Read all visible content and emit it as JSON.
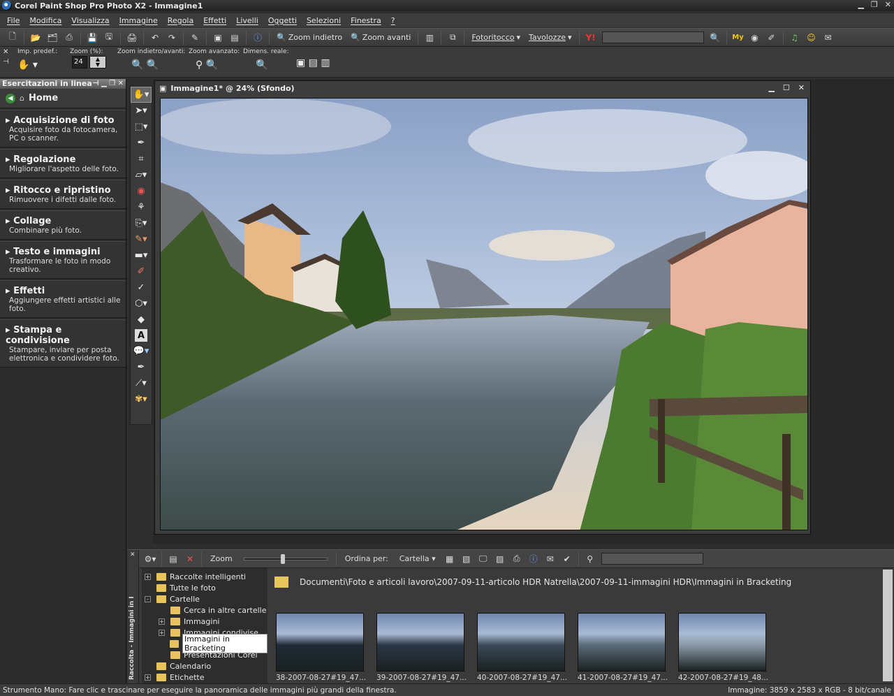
{
  "window": {
    "title": "Corel Paint Shop Pro Photo X2 - Immagine1"
  },
  "menu": [
    "File",
    "Modifica",
    "Visualizza",
    "Immagine",
    "Regola",
    "Effetti",
    "Livelli",
    "Oggetti",
    "Selezioni",
    "Finestra",
    "?"
  ],
  "toolbar": {
    "zoom_out": "Zoom indietro",
    "zoom_in": "Zoom avanti",
    "fotoritocco": "Fotoritocco",
    "tavolozze": "Tavolozze",
    "my": "My"
  },
  "tooloptions": {
    "preset": "Imp. predef.:",
    "zoom_pct": "Zoom (%):",
    "zoom_value": "24",
    "zoom_inout": "Zoom indietro/avanti:",
    "zoom_adv": "Zoom avanzato:",
    "real_size": "Dimens. reale:"
  },
  "learning": {
    "title": "Esercitazioni in linea",
    "home": "Home",
    "items": [
      {
        "h": "Acquisizione di foto",
        "d": "Acquisire foto da fotocamera, PC o scanner."
      },
      {
        "h": "Regolazione",
        "d": "Migliorare l'aspetto delle foto."
      },
      {
        "h": "Ritocco e ripristino",
        "d": "Rimuovere i difetti dalle foto."
      },
      {
        "h": "Collage",
        "d": "Combinare più foto."
      },
      {
        "h": "Testo e immagini",
        "d": "Trasformare le foto in modo creativo."
      },
      {
        "h": "Effetti",
        "d": "Aggiungere effetti artistici alle foto."
      },
      {
        "h": "Stampa e condivisione",
        "d": "Stampare, inviare per posta elettronica e condividere foto."
      }
    ]
  },
  "image_window": {
    "title": "Immagine1* @  24% (Sfondo)"
  },
  "organizer": {
    "side_title": "Raccolta - Immagini in I",
    "zoom": "Zoom",
    "sort_by": "Ordina per:",
    "sort_value": "Cartella",
    "path": "Documenti\\Foto e articoli lavoro\\2007-09-11-articolo HDR Natrella\\2007-09-11-immagini HDR\\Immagini in Bracketing",
    "tree": [
      {
        "label": "Raccolte intelligenti",
        "indent": 0,
        "exp": "+"
      },
      {
        "label": "Tutte le foto",
        "indent": 0,
        "exp": ""
      },
      {
        "label": "Cartelle",
        "indent": 0,
        "exp": "-"
      },
      {
        "label": "Cerca in altre cartelle",
        "indent": 1,
        "exp": ""
      },
      {
        "label": "Immagini",
        "indent": 1,
        "exp": "+"
      },
      {
        "label": "Immagini condivise",
        "indent": 1,
        "exp": "+"
      },
      {
        "label": "Immagini in Bracketing",
        "indent": 1,
        "exp": "",
        "selected": true
      },
      {
        "label": "Presentazioni Corel",
        "indent": 1,
        "exp": ""
      },
      {
        "label": "Calendario",
        "indent": 0,
        "exp": ""
      },
      {
        "label": "Etichette",
        "indent": 0,
        "exp": "+"
      }
    ],
    "thumbs": [
      "38-2007-08-27#19_47...",
      "39-2007-08-27#19_47...",
      "40-2007-08-27#19_47...",
      "41-2007-08-27#19_47...",
      "42-2007-08-27#19_48..."
    ]
  },
  "status": {
    "left": "Strumento Mano: Fare clic e trascinare per eseguire la panoramica delle immagini più grandi della finestra.",
    "right": "Immagine:  3859 x 2583 x RGB - 8 bit/canale"
  }
}
